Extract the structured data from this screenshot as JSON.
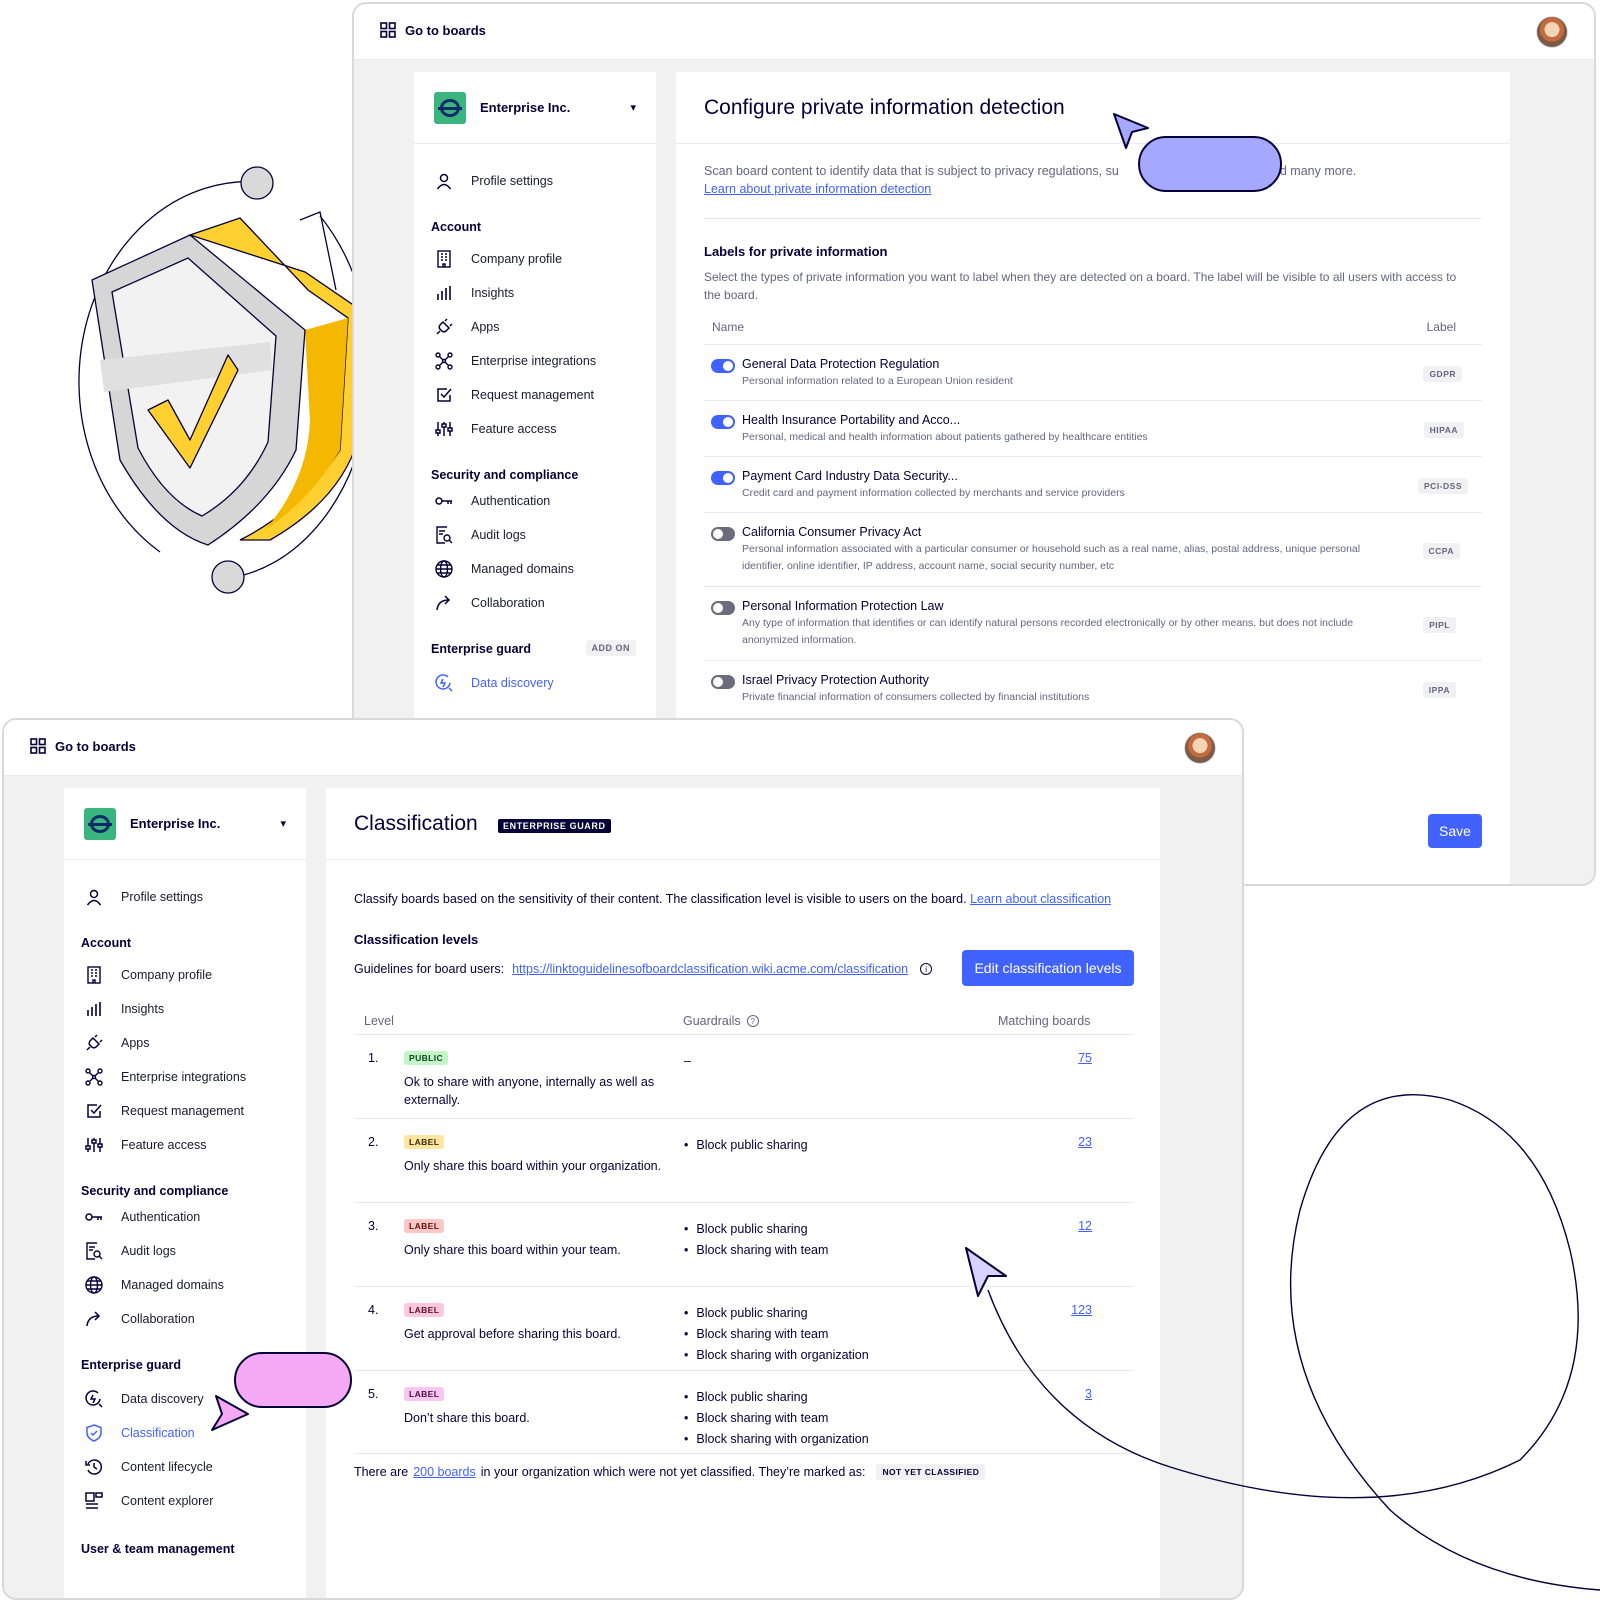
{
  "colors": {
    "accent": "#4262ff",
    "bubble_purple": "#a5a8fc",
    "bubble_pink": "#f5a9f5",
    "shield_yellow": "#ffd02f",
    "badge_public": "#c3f5c8",
    "badge_label_yellow": "#ffe6a3",
    "badge_label_pink": "#ffc6c6",
    "badge_label_magenta": "#f8c6f1"
  },
  "back": {
    "topbar": {
      "goto_label": "Go to boards",
      "goto_icon": "grid-icon",
      "avatar_icon": "avatar"
    },
    "sidebar": {
      "org_name": "Enterprise Inc.",
      "profile_settings": "Profile settings",
      "account_heading": "Account",
      "account_items": [
        "Company profile",
        "Insights",
        "Apps",
        "Enterprise integrations",
        "Request management",
        "Feature access"
      ],
      "security_heading": "Security and compliance",
      "security_items": [
        "Authentication",
        "Audit logs",
        "Managed domains",
        "Collaboration"
      ],
      "guard_heading": "Enterprise guard",
      "addon_badge": "ADD ON",
      "guard_items": [
        "Data discovery"
      ]
    },
    "main": {
      "title": "Configure private information detection",
      "intro_a": "Scan board content to identify data that is subject to privacy regulations, su",
      "intro_b": "A and many more.",
      "intro_link": "Learn about private information detection",
      "labels_heading": "Labels for private information",
      "labels_desc": "Select the types of private information you want to label when they are detected on a board. The label will be visible to all users with access to the board.",
      "col_name": "Name",
      "col_label": "Label",
      "rows": [
        {
          "name": "General Data Protection Regulation",
          "desc": "Personal information related to a European Union resident",
          "tag": "GDPR",
          "enabled": true
        },
        {
          "name": "Health Insurance Portability and Acco...",
          "desc": "Personal, medical and health information about patients gathered by healthcare entities",
          "tag": "HIPAA",
          "enabled": true
        },
        {
          "name": "Payment Card Industry Data Security...",
          "desc": "Credit card and payment information collected by merchants and service providers",
          "tag": "PCI-DSS",
          "enabled": true
        },
        {
          "name": "California Consumer Privacy Act",
          "desc": "Personal information associated with a particular consumer or household such as a real name, alias, postal address, unique personal identifier, online identifier, IP address, account name, social security number, etc",
          "tag": "CCPA",
          "enabled": false
        },
        {
          "name": "Personal Information Protection Law",
          "desc": "Any type of information that identifies or can identify natural persons recorded electronically or by other means, but does not include anonymized information.",
          "tag": "PIPL",
          "enabled": false
        },
        {
          "name": "Israel Privacy Protection Authority",
          "desc": "Private financial information of consumers collected by financial institutions",
          "tag": "IPPA",
          "enabled": false
        }
      ],
      "save_label": "Save"
    }
  },
  "front": {
    "topbar": {
      "goto_label": "Go to boards"
    },
    "sidebar": {
      "org_name": "Enterprise Inc.",
      "profile_settings": "Profile settings",
      "account_heading": "Account",
      "account_items": [
        "Company profile",
        "Insights",
        "Apps",
        "Enterprise integrations",
        "Request management",
        "Feature access"
      ],
      "security_heading": "Security and compliance",
      "security_items": [
        "Authentication",
        "Audit logs",
        "Managed domains",
        "Collaboration"
      ],
      "guard_heading": "Enterprise guard",
      "guard_items": [
        "Data discovery",
        "Classification",
        "Content lifecycle",
        "Content explorer"
      ],
      "user_heading": "User & team management"
    },
    "main": {
      "title": "Classification",
      "title_badge": "ENTERPRISE GUARD",
      "intro": "Classify boards based on the sensitivity of their content. The classification level is visible to users on the board.",
      "intro_link": "Learn about classification",
      "levels_heading": "Classification levels",
      "guidelines_label": "Guidelines for board users:",
      "guidelines_link": "https://linktoguidelinesofboardclassification.wiki.acme.com/classification",
      "edit_button": "Edit classification levels",
      "col_level": "Level",
      "col_guardrails": "Guardrails",
      "col_matching": "Matching boards",
      "levels": [
        {
          "num": "1.",
          "badge": "PUBLIC",
          "desc": "Ok to share with anyone, internally as well as externally.",
          "guardrails": [],
          "guardrail_empty": "–",
          "matching": "75"
        },
        {
          "num": "2.",
          "badge": "LABEL",
          "desc": "Only share this board within your organization.",
          "guardrails": [
            "Block public sharing"
          ],
          "matching": "23"
        },
        {
          "num": "3.",
          "badge": "LABEL",
          "desc": "Only share this board within your team.",
          "guardrails": [
            "Block public sharing",
            "Block sharing with team"
          ],
          "matching": "12"
        },
        {
          "num": "4.",
          "badge": "LABEL",
          "desc": "Get approval before sharing this board.",
          "guardrails": [
            "Block public sharing",
            "Block sharing with team",
            "Block sharing with organization"
          ],
          "matching": "123"
        },
        {
          "num": "5.",
          "badge": "LABEL",
          "desc": "Don’t share this board.",
          "guardrails": [
            "Block public sharing",
            "Block sharing with team",
            "Block sharing with organization"
          ],
          "matching": "3"
        }
      ],
      "footer_a": "There are",
      "footer_link": "200 boards",
      "footer_b": "in your organization which were not yet classified. They’re marked as:",
      "footer_badge": "NOT YET CLASSIFIED"
    }
  }
}
